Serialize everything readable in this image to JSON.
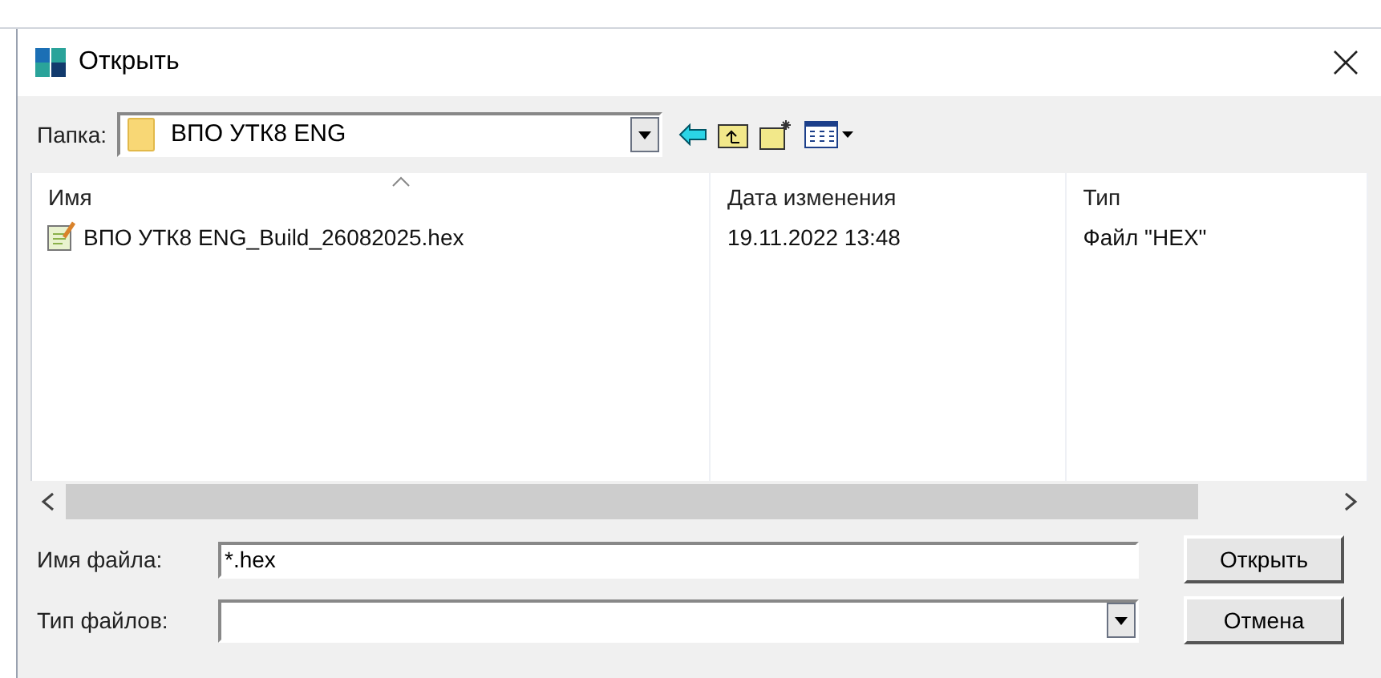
{
  "window": {
    "title": "Открыть"
  },
  "folder": {
    "label": "Папка:",
    "value": "ВПО УТК8 ENG"
  },
  "table": {
    "columns": [
      {
        "label": "Имя",
        "sorted": true
      },
      {
        "label": "Дата изменения",
        "sorted": false
      },
      {
        "label": "Тип",
        "sorted": false
      }
    ],
    "rows": [
      {
        "name": "ВПО УТК8 ENG_Build_26082025.hex",
        "date": "19.11.2022 13:48",
        "type": "Файл \"HEX\""
      }
    ]
  },
  "file_name": {
    "label": "Имя файла:",
    "value": "*.hex"
  },
  "file_type": {
    "label": "Тип файлов:"
  },
  "buttons": [
    "Открыть",
    "Отмена"
  ]
}
